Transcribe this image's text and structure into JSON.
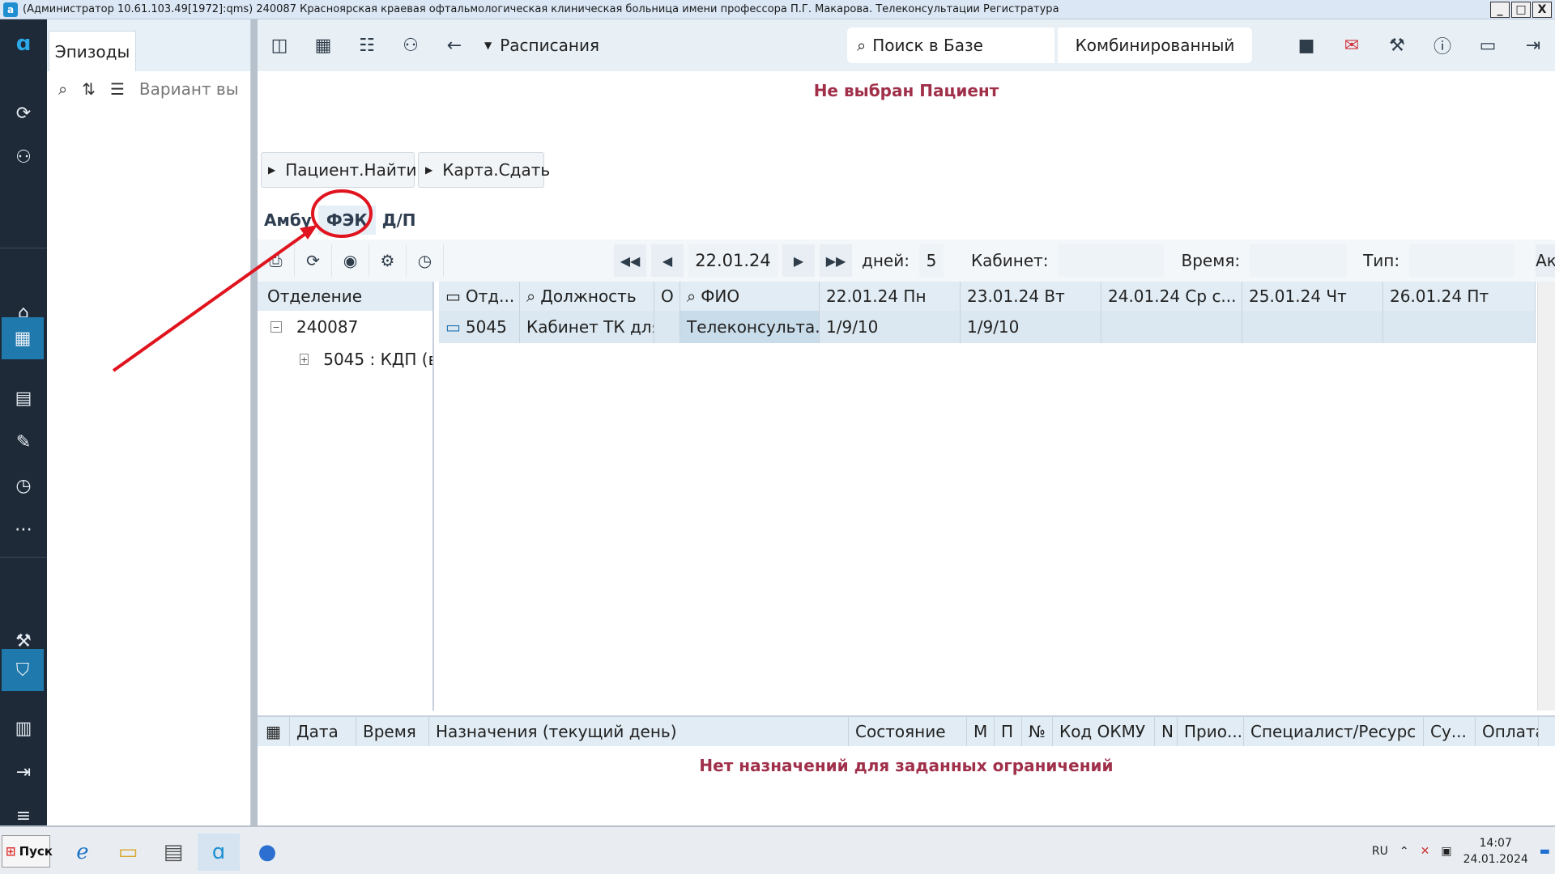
{
  "window": {
    "title": "(Администратор 10.61.103.49[1972]:qms)  240087 Красноярская краевая офтальмологическая клиническая больница имени профессора П.Г. Макарова. Телеконсультации Регистратура",
    "app_icon": "a",
    "min": "_",
    "max": "□",
    "close": "X"
  },
  "rail": {
    "items": [
      {
        "name": "logo-icon",
        "glyph": "ɑ"
      },
      {
        "name": "sync-icon",
        "glyph": "⟳"
      },
      {
        "name": "add-user-icon",
        "glyph": "⚇"
      },
      {
        "name": "home-icon",
        "glyph": "⌂"
      },
      {
        "name": "calendar-icon",
        "glyph": "▦"
      },
      {
        "name": "id-card-icon",
        "glyph": "▤"
      },
      {
        "name": "clipboard-icon",
        "glyph": "✎"
      },
      {
        "name": "history-icon",
        "glyph": "◷"
      },
      {
        "name": "more-icon",
        "glyph": "⋯"
      },
      {
        "name": "wrench-icon",
        "glyph": "⚒"
      },
      {
        "name": "shield-icon",
        "glyph": "⛉"
      },
      {
        "name": "calendar-small-icon",
        "glyph": "▥"
      },
      {
        "name": "logout-icon",
        "glyph": "⇥"
      },
      {
        "name": "menu-icon",
        "glyph": "≡"
      }
    ]
  },
  "episodes": {
    "tab_label": "Эпизоды",
    "variant_placeholder": "Вариант вы"
  },
  "toolbar": {
    "schedule_label": "Расписания",
    "search_label": "Поиск в Базе",
    "combined_label": "Комбинированный"
  },
  "patient_banner": "Не выбран Пациент",
  "actions": {
    "find_patient": "Пациент.Найти",
    "give_card": "Карта.Сдать"
  },
  "subtabs": {
    "ambu": "Амбу",
    "fek": "ФЭК",
    "dp": "Д/П"
  },
  "grid_toolbar": {
    "date": "22.01.24",
    "days_label": "дней:",
    "days_value": "5",
    "cabinet_label": "Кабинет:",
    "time_label": "Время:",
    "type_label": "Тип:",
    "active_label": "Активк"
  },
  "tree": {
    "header": "Отделение",
    "root": "240087",
    "child": "5045 : КДП (в"
  },
  "schedule": {
    "columns": [
      "Отд...",
      "Должность",
      "О",
      "ФИО",
      "22.01.24 Пн",
      "23.01.24 Вт",
      "24.01.24 Ср с...",
      "25.01.24 Чт",
      "26.01.24 Пт"
    ],
    "row": {
      "dept": "5045",
      "position": "Кабинет ТК для г...",
      "o": "",
      "fio": "Телеконсульта...",
      "d1": "1/9/10",
      "d2": "1/9/10",
      "d3": "",
      "d4": "",
      "d5": ""
    }
  },
  "assignments": {
    "columns": [
      "Дата",
      "Время",
      "Назначения (текущий день)",
      "Состояние",
      "М",
      "П",
      "№",
      "Код ОКМУ",
      "N",
      "Прио...",
      "Специалист/Ресурс",
      "Су...",
      "Оплата"
    ],
    "empty_message": "Нет назначений для заданных ограничений"
  },
  "taskbar": {
    "start_label": "Пуск",
    "lang": "RU",
    "time": "14:07",
    "date": "24.01.2024"
  },
  "colors": {
    "rail_bg": "#1e2a38",
    "accent": "#1f79ad",
    "alert_text": "#a0304a",
    "annotation": "#e0141e"
  }
}
